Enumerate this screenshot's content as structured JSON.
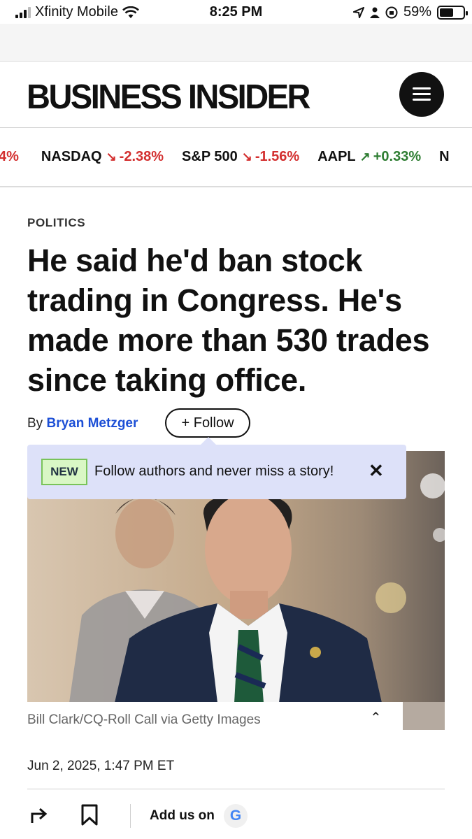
{
  "status_bar": {
    "carrier": "Xfinity Mobile",
    "time": "8:25 PM",
    "battery": "59%",
    "battery_level": 0.59
  },
  "header": {
    "logo": "BUSINESS INSIDER",
    "menu_icon": "hamburger-menu-icon"
  },
  "ticker": [
    {
      "name": "",
      "value": "4%",
      "direction": "down"
    },
    {
      "name": "NASDAQ",
      "value": "-2.38%",
      "direction": "down"
    },
    {
      "name": "S&P 500",
      "value": "-1.56%",
      "direction": "down"
    },
    {
      "name": "AAPL",
      "value": "+0.33%",
      "direction": "up"
    },
    {
      "name": "N",
      "value": "",
      "direction": ""
    }
  ],
  "article": {
    "category": "POLITICS",
    "headline": "He said he'd ban stock trading in Congress. He's made more than 530 trades since taking office.",
    "byline_prefix": "By",
    "author": "Bryan Metzger",
    "follow_label": "+ Follow",
    "image_caption": "Bill Clark/CQ-Roll Call via Getty Images",
    "date": "Jun 2, 2025, 1:47 PM ET"
  },
  "tooltip": {
    "badge": "NEW",
    "text": "Follow authors and never miss a story!",
    "close": "✕"
  },
  "actions": {
    "add_us_label": "Add us on",
    "google_letter": "G"
  },
  "colors": {
    "accent_link": "#1c4fd6",
    "down": "#d32f2f",
    "up": "#2e7d32",
    "tooltip_bg": "#dde1f9"
  }
}
